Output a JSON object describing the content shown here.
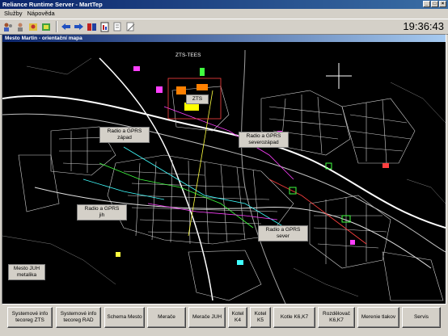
{
  "window": {
    "title": "Reliance Runtime Server - MartTep"
  },
  "menu": [
    {
      "label": "Služby"
    },
    {
      "label": "Nápověda"
    }
  ],
  "toolbar": {
    "time": "19:36:43"
  },
  "view": {
    "title": "Mesto Martin - orientační mapa"
  },
  "map_labels": {
    "zts": "ZTS",
    "zts_top": "ZTS-ТЕЕS",
    "radio_zapad": "Radio a GPRS\nzápad",
    "radio_severozapad": "Radio a GPRS\nseverozápad",
    "radio_jih": "Radio a GPRS\njih",
    "radio_sever": "Radio a GPRS\nsever",
    "mesto_juh": "Mesto JUH\nmetalika"
  },
  "buttons": [
    {
      "label": "Systemové info\ntecoreg ZTS"
    },
    {
      "label": "Systemové info\ntecoreg RAD"
    },
    {
      "label": "Schema Mesto"
    },
    {
      "label": "Merače"
    },
    {
      "label": "Merače JUH"
    },
    {
      "label": "Kotel\nK4"
    },
    {
      "label": "Kotel\nK5"
    },
    {
      "label": "Kotle K6,K7"
    },
    {
      "label": "Rozdělovač\nK6,K7"
    },
    {
      "label": "Merenie tlakov"
    },
    {
      "label": "Servis"
    }
  ]
}
